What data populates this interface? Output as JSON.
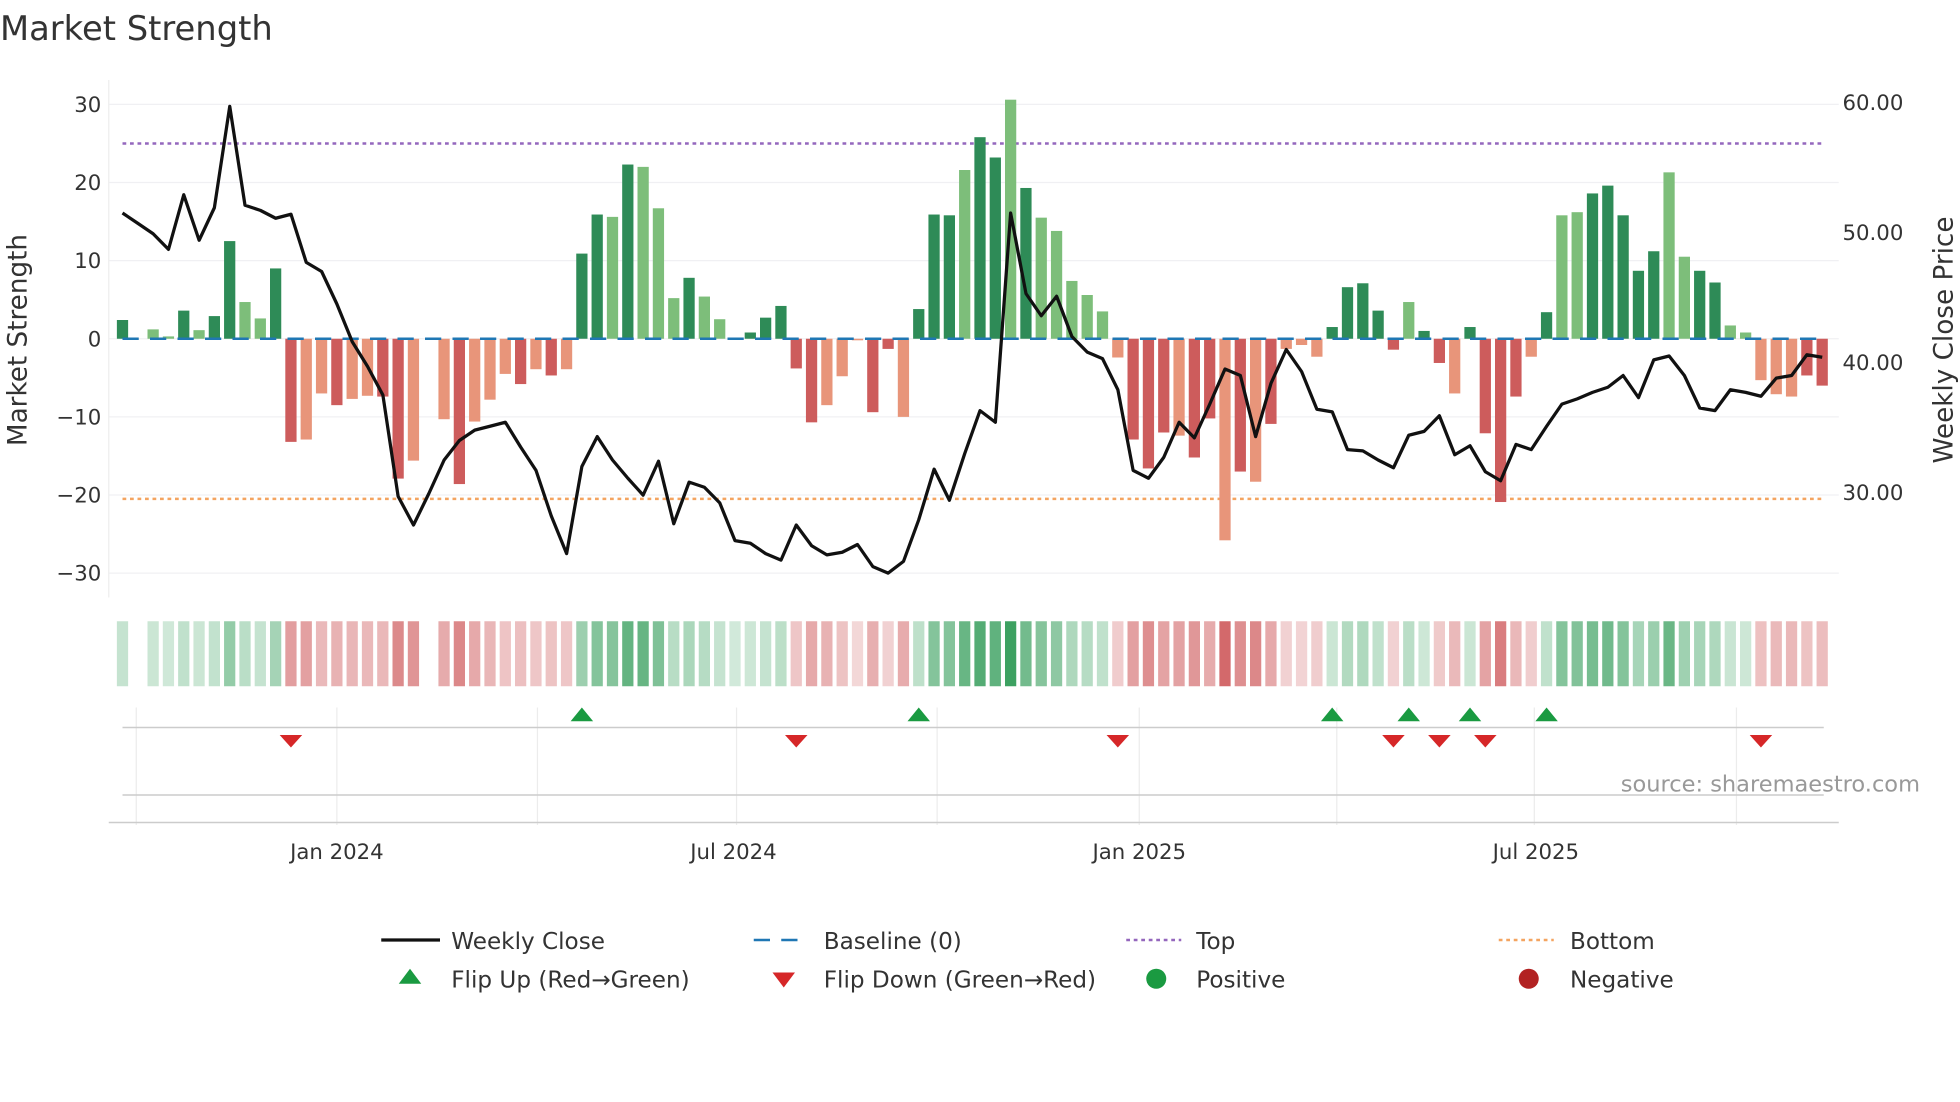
{
  "title": "Market Strength",
  "source": "source: sharemaestro.com",
  "colors": {
    "pos_dark": "#2e8b57",
    "pos_light": "#7dbe7a",
    "neg_dark": "#cd5c5c",
    "neg_light": "#e8957a",
    "close": "#111111",
    "baseline": "#1f77b4",
    "top": "#9467bd",
    "bottom": "#f4a460",
    "flip_up": "#1a9a41",
    "flip_down": "#d62728",
    "heat_pos": "#2e9a55",
    "heat_neg": "#c9484a",
    "positive": "#1a9a41",
    "negative": "#b22222"
  },
  "legend": {
    "weekly_close": "Weekly Close",
    "baseline": "Baseline (0)",
    "top": "Top",
    "bottom": "Bottom",
    "flip_up": "Flip Up (Red→Green)",
    "flip_down": "Flip Down (Green→Red)",
    "positive": "Positive",
    "negative": "Negative"
  },
  "chart_data": {
    "type": "bar",
    "title": "Market Strength",
    "ylabel": "Market Strength",
    "y2label": "Weekly Close Price",
    "ylim": [
      -33,
      33
    ],
    "y2lim": [
      22.5,
      62
    ],
    "yticks": [
      {
        "v": 30,
        "label": "30"
      },
      {
        "v": 20,
        "label": "20"
      },
      {
        "v": 10,
        "label": "10"
      },
      {
        "v": 0,
        "label": "0"
      },
      {
        "v": -10,
        "label": "−10"
      },
      {
        "v": -20,
        "label": "−20"
      },
      {
        "v": -30,
        "label": "−30"
      }
    ],
    "y2ticks": [
      {
        "v": 60,
        "label": "60.00"
      },
      {
        "v": 50,
        "label": "50.00"
      },
      {
        "v": 40,
        "label": "40.00"
      },
      {
        "v": 30,
        "label": "30.00"
      }
    ],
    "xticks": [
      {
        "label": "Jan 2024",
        "week": 14.0
      },
      {
        "label": "Jul 2024",
        "week": 39.9
      },
      {
        "label": "Jan 2025",
        "week": 66.4
      },
      {
        "label": "Jul 2025",
        "week": 92.3
      }
    ],
    "top_threshold": 25,
    "bottom_threshold": -20.5,
    "baseline": 0,
    "strength": [
      2.4,
      null,
      1.2,
      0.3,
      3.6,
      1.1,
      2.9,
      12.5,
      4.7,
      2.6,
      9.0,
      -13.2,
      -12.9,
      -7.0,
      -8.5,
      -7.7,
      -7.3,
      -7.4,
      -17.9,
      -15.6,
      null,
      -10.3,
      -18.6,
      -10.6,
      -7.8,
      -4.5,
      -5.8,
      -3.9,
      -4.7,
      -3.9,
      10.9,
      15.9,
      15.6,
      22.3,
      22.0,
      16.7,
      5.2,
      7.8,
      5.4,
      2.5,
      0.1,
      0.8,
      2.7,
      4.2,
      -3.8,
      -10.7,
      -8.5,
      -4.8,
      -0.2,
      -9.4,
      -1.3,
      -10.0,
      3.8,
      15.9,
      15.8,
      21.6,
      25.8,
      23.2,
      30.6,
      19.3,
      15.5,
      13.8,
      7.4,
      5.6,
      3.5,
      -2.4,
      -12.9,
      -16.6,
      -12.0,
      -12.4,
      -15.2,
      -10.2,
      -25.8,
      -17.0,
      -18.3,
      -10.9,
      -1.3,
      -0.8,
      -2.3,
      1.5,
      6.6,
      7.1,
      3.6,
      -1.4,
      4.7,
      1.0,
      -3.1,
      -7.0,
      1.5,
      -12.1,
      -20.9,
      -7.4,
      -2.3,
      3.4,
      15.8,
      16.2,
      18.6,
      19.6,
      15.8,
      8.7,
      11.2,
      21.3,
      10.5,
      8.7,
      7.2,
      1.7,
      0.8,
      -5.3,
      -7.1,
      -7.4,
      -4.7,
      -6.0
    ],
    "shade": "dxlldlddllddlldllddlxldllldldlddldllldllldddddlllddldddlddldlllllldddlddldldllldddddlddlddddldlldddddllddlllllddd ld",
    "close": [
      51.5,
      50.7,
      49.9,
      48.7,
      52.9,
      49.4,
      51.9,
      59.7,
      52.1,
      51.7,
      51.1,
      51.4,
      47.7,
      47.0,
      44.5,
      41.6,
      39.7,
      37.5,
      29.7,
      27.5,
      29.9,
      32.5,
      34.0,
      34.8,
      35.1,
      35.4,
      33.5,
      31.7,
      28.2,
      25.3,
      32.0,
      34.3,
      32.5,
      31.1,
      29.8,
      32.4,
      27.6,
      30.8,
      30.4,
      29.2,
      26.3,
      26.1,
      25.3,
      24.8,
      27.5,
      25.9,
      25.2,
      25.4,
      26.0,
      24.3,
      23.8,
      24.7,
      27.9,
      31.8,
      29.4,
      33.0,
      36.3,
      35.4,
      51.5,
      45.3,
      43.6,
      45.1,
      42.0,
      40.8,
      40.3,
      37.9,
      31.7,
      31.1,
      32.7,
      35.4,
      34.2,
      36.8,
      39.5,
      39.0,
      34.3,
      38.4,
      41.0,
      39.3,
      36.4,
      36.2,
      33.3,
      33.2,
      32.5,
      31.9,
      34.4,
      34.7,
      35.9,
      32.9,
      33.6,
      31.6,
      30.9,
      33.7,
      33.3,
      35.1,
      36.8,
      37.2,
      37.7,
      38.1,
      39.0,
      37.3,
      40.2,
      40.5,
      39.0,
      36.5,
      36.3,
      37.9,
      37.7,
      37.4,
      38.8,
      39.0,
      40.6,
      40.4
    ],
    "flip_up_weeks": [
      31,
      53,
      80,
      85,
      89,
      94
    ],
    "flip_down_weeks": [
      12,
      45,
      66,
      84,
      87,
      90,
      108
    ],
    "legend_position": "bottom"
  }
}
